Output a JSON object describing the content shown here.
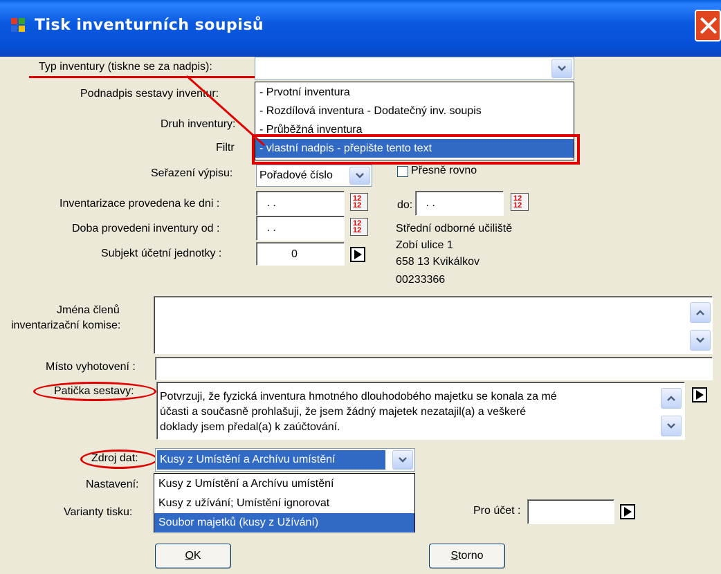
{
  "window": {
    "title": "Tisk inventurních soupisů"
  },
  "form": {
    "typ_label": "Typ inventury (tiskne se za nadpis):",
    "typ_value": "",
    "podnadpis_label": "Podnadpis sestavy inventur:",
    "druh_label": "Druh inventury:",
    "filtr_label": "Filtr",
    "serazeni_label": "Seřazení výpisu:",
    "serazeni_value": "Pořadové číslo",
    "presne_label": "Přesně rovno",
    "ke_dni_label": "Inventarizace provedena ke dni :",
    "ke_dni_value": " . .",
    "do_label": "do:",
    "do_value": " . .",
    "doba_label": "Doba provedeni inventury od :",
    "doba_value": " . .",
    "subjekt_label": "Subjekt účetní jednotky :",
    "subjekt_value": "0",
    "org_line1": "Střední odborné učiliště",
    "org_line2": "Zobí ulice 1",
    "org_line3": "658 13 Kvikálkov",
    "org_line4": "00233366",
    "jmena_label_1": "Jména členů",
    "jmena_label_2": "inventarizační komise:",
    "jmena_value": "",
    "misto_label": "Místo vyhotovení :",
    "misto_value": "",
    "paticka_label": "Patička sestavy:",
    "paticka_line1": "Potvrzuji, že fyzická inventura hmotného dlouhodobého majetku se konala za mé",
    "paticka_line2": "účasti a současně prohlašuji, že jsem žádný majetek nezatajil(a) a veškeré",
    "paticka_line3": "doklady jsem předal(a) k zaúčtování.",
    "zdroj_label": "Zdroj dat:",
    "zdroj_value": "Kusy z Umístění a Archívu umístění",
    "nastaveni_label": "Nastavení:",
    "varianty_label": "Varianty tisku:",
    "pro_ucet_label": "Pro účet :",
    "pro_ucet_value": ""
  },
  "typ_dropdown": [
    "- Prvotní inventura",
    "- Rozdílová inventura - Dodatečný inv. soupis",
    "- Průběžná inventura",
    "- vlastní nadpis - přepište tento text"
  ],
  "typ_selected_index": 3,
  "zdroj_dropdown": [
    "Kusy z Umístění a Archívu umístění",
    "Kusy z užívání; Umístění ignorovat",
    "Soubor majetků (kusy z Užívání)"
  ],
  "zdroj_selected_index": 2,
  "buttons": {
    "ok_ul": "O",
    "ok_rest": "K",
    "storno_ul": "S",
    "storno_rest": "torno"
  },
  "colors": {
    "accent": "#316ac5",
    "annotation": "#e00000",
    "titlebar": "#0a5fe0"
  }
}
